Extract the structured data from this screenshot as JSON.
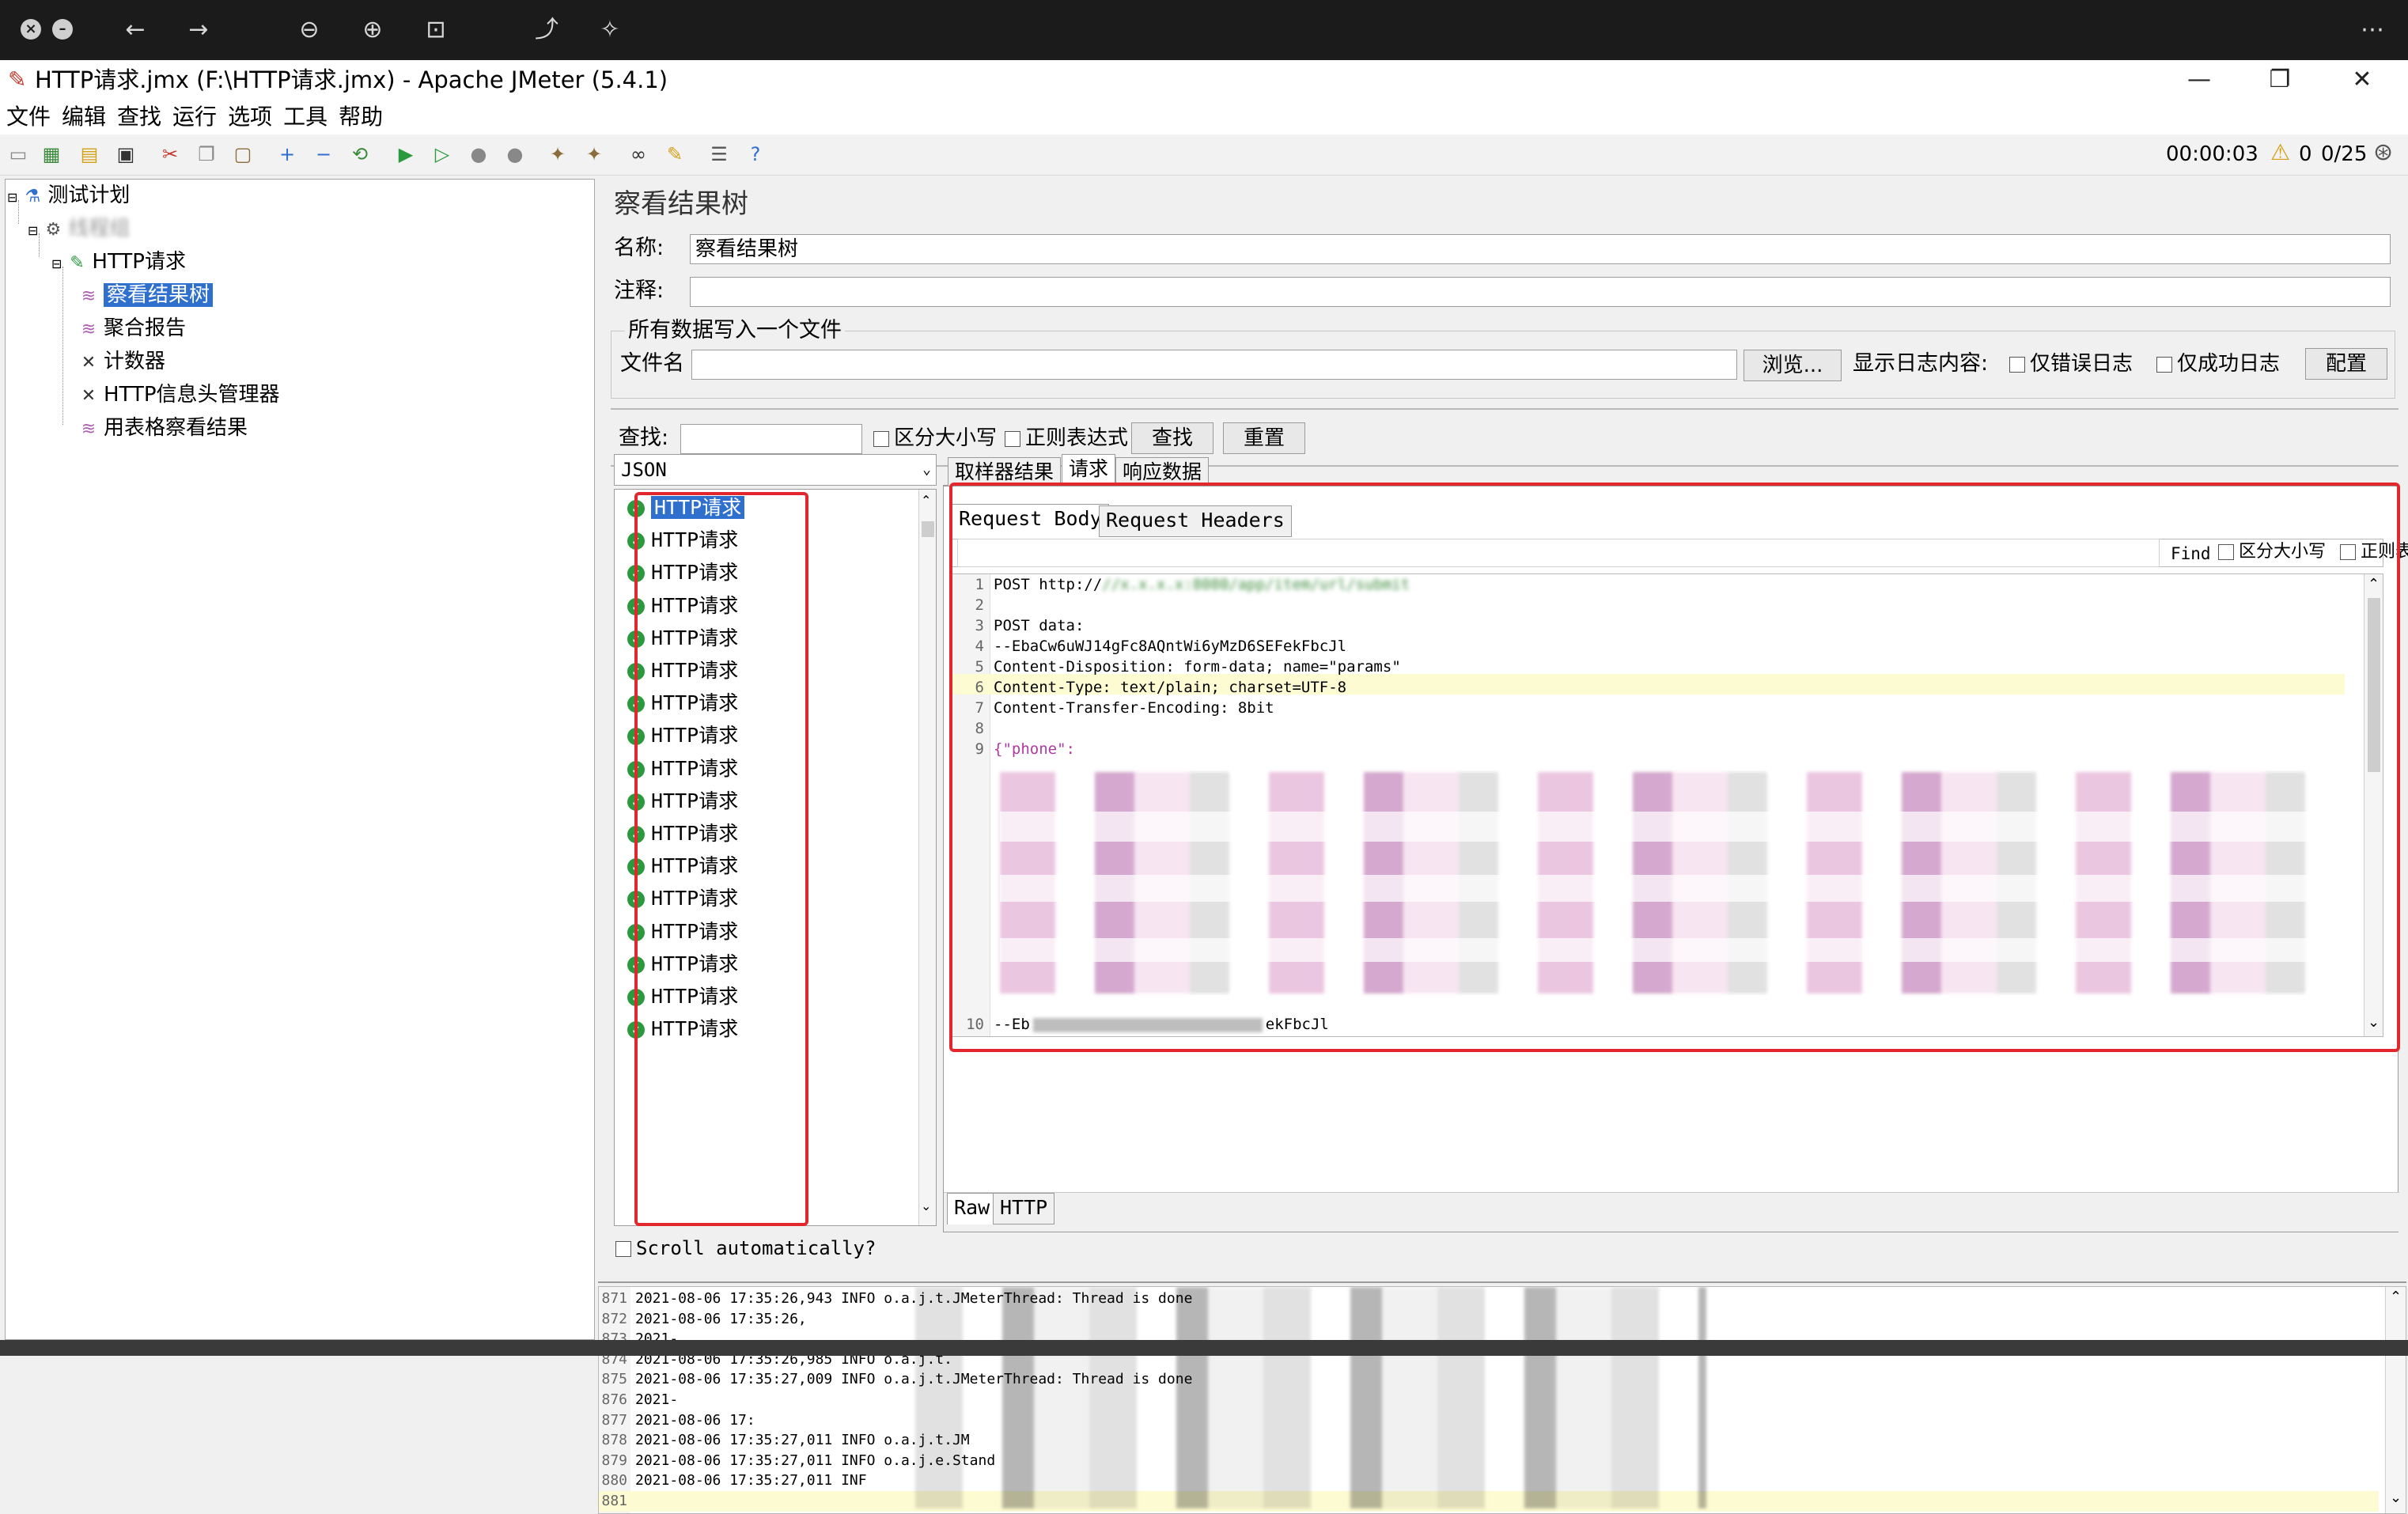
{
  "window": {
    "title": "HTTP请求.jmx (F:\\HTTP请求.jmx) - Apache JMeter (5.4.1)",
    "minimize": "—",
    "maximize": "❐",
    "close": "✕"
  },
  "menu": [
    "文件",
    "编辑",
    "查找",
    "运行",
    "选项",
    "工具",
    "帮助"
  ],
  "toolbar": {
    "timer": "00:00:03",
    "warnings": "0",
    "threads": "0/25"
  },
  "tree": {
    "root": "测试计划",
    "thread_group": "线程组",
    "http_request": "HTTP请求",
    "children": [
      "察看结果树",
      "聚合报告",
      "计数器",
      "HTTP信息头管理器",
      "用表格察看结果"
    ]
  },
  "panel": {
    "title": "察看结果树",
    "name_label": "名称:",
    "name_value": "察看结果树",
    "comment_label": "注释:",
    "comment_value": "",
    "file_section": "所有数据写入一个文件",
    "filename_label": "文件名",
    "browse": "浏览...",
    "log_label": "显示日志内容:",
    "errors_only": "仅错误日志",
    "success_only": "仅成功日志",
    "config": "配置",
    "search_label": "查找:",
    "case_sensitive": "区分大小写",
    "regex": "正则表达式",
    "search_btn": "查找",
    "reset_btn": "重置"
  },
  "results": {
    "renderer": "JSON",
    "items": [
      "HTTP请求",
      "HTTP请求",
      "HTTP请求",
      "HTTP请求",
      "HTTP请求",
      "HTTP请求",
      "HTTP请求",
      "HTTP请求",
      "HTTP请求",
      "HTTP请求",
      "HTTP请求",
      "HTTP请求",
      "HTTP请求",
      "HTTP请求",
      "HTTP请求",
      "HTTP请求",
      "HTTP请求"
    ],
    "scroll_auto": "Scroll automatically?"
  },
  "detail": {
    "tabs": [
      "取样器结果",
      "请求",
      "响应数据"
    ],
    "subtabs": [
      "Request Body",
      "Request Headers"
    ],
    "find_label": "Find",
    "case_sensitive": "区分大小写",
    "regex": "正则表达式",
    "bottom_tabs": [
      "Raw",
      "HTTP"
    ],
    "code": [
      {
        "n": "1",
        "t": "POST http://"
      },
      {
        "n": "2",
        "t": ""
      },
      {
        "n": "3",
        "t": "POST data:"
      },
      {
        "n": "4",
        "t": "--EbaCw6uWJ14gFc8AQntWi6yMzD6SEFekFbcJl"
      },
      {
        "n": "5",
        "t": "Content-Disposition: form-data; name=\"params\""
      },
      {
        "n": "6",
        "t": "Content-Type: text/plain; charset=UTF-8"
      },
      {
        "n": "7",
        "t": "Content-Transfer-Encoding: 8bit"
      },
      {
        "n": "8",
        "t": ""
      },
      {
        "n": "9",
        "t": "{\"phone\":"
      }
    ],
    "line10": {
      "n": "10",
      "t": "--Eb"
    },
    "line10_tail": "ekFbcJl"
  },
  "log": [
    {
      "n": "871",
      "t": "2021-08-06 17:35:26,943 INFO o.a.j.t.JMeterThread: Thread is done"
    },
    {
      "n": "872",
      "t": "2021-08-06 17:35:26,"
    },
    {
      "n": "873",
      "t": "2021-"
    },
    {
      "n": "874",
      "t": "2021-08-06 17:35:26,985 INFO o.a.j.t."
    },
    {
      "n": "875",
      "t": "2021-08-06 17:35:27,009 INFO o.a.j.t.JMeterThread: Thread is done"
    },
    {
      "n": "876",
      "t": "2021-"
    },
    {
      "n": "877",
      "t": "2021-08-06 17:"
    },
    {
      "n": "878",
      "t": "2021-08-06 17:35:27,011 INFO o.a.j.t.JM"
    },
    {
      "n": "879",
      "t": "2021-08-06 17:35:27,011 INFO o.a.j.e.Stand"
    },
    {
      "n": "880",
      "t": "2021-08-06 17:35:27,011 INF"
    },
    {
      "n": "881",
      "t": ""
    }
  ]
}
